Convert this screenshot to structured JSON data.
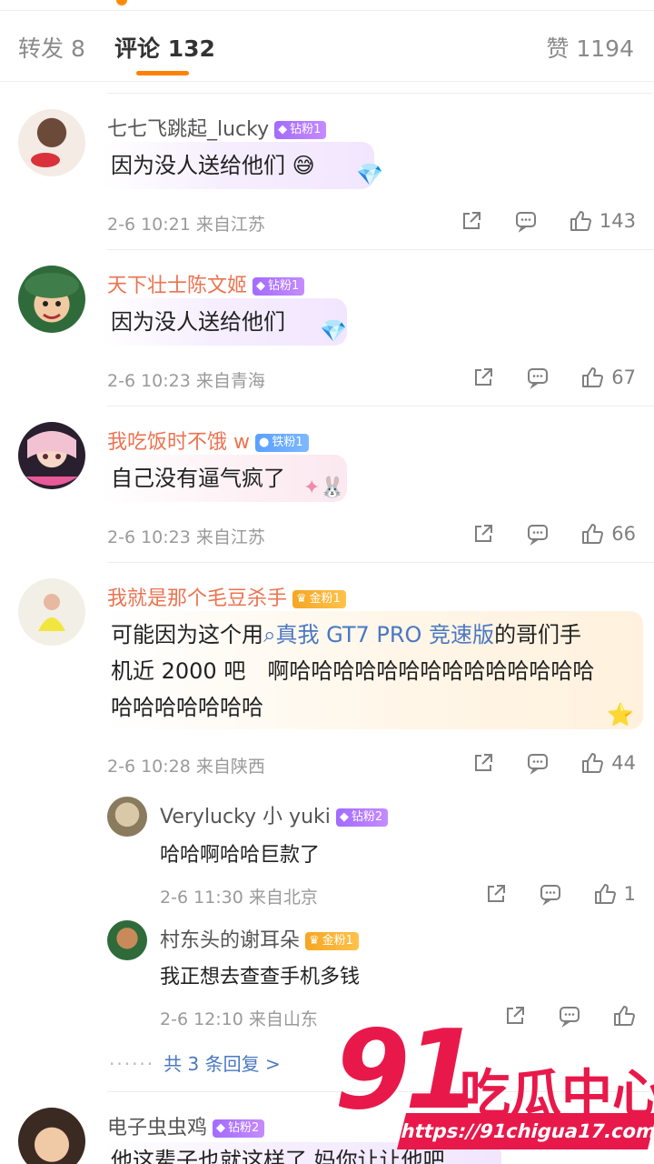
{
  "tabs": {
    "repost": "转发 8",
    "comment": "评论 132",
    "like": "赞 1194"
  },
  "comments": [
    {
      "user": "七七飞跳起_lucky",
      "badge": "钻粉1",
      "text": "因为没人送给他们",
      "time": "2-6 10:21 来自江苏",
      "likes": "143"
    },
    {
      "user": "天下壮士陈文姬",
      "badge": "钻粉1",
      "text": "因为没人送给他们",
      "time": "2-6 10:23 来自青海",
      "likes": "67"
    },
    {
      "user": "我吃饭时不饿 w",
      "badge": "铁粉1",
      "text": "自己没有逼气疯了",
      "time": "2-6 10:23 来自江苏",
      "likes": "66"
    },
    {
      "user": "我就是那个毛豆杀手",
      "badge": "金粉1",
      "text_pre": "可能因为这个用",
      "link": "真我 GT7 PRO 竞速版",
      "text_post": "的哥们手",
      "line2": "机近 2000 吧　啊哈哈哈哈哈哈哈哈哈哈哈哈哈哈",
      "line3": "哈哈哈哈哈哈哈",
      "time": "2-6 10:28 来自陕西",
      "likes": "44",
      "replies": [
        {
          "user": "Verylucky 小 yuki",
          "badge": "钻粉2",
          "text": "哈哈啊哈哈巨款了",
          "time": "2-6 11:30 来自北京",
          "likes": "1"
        },
        {
          "user": "村东头的谢耳朵",
          "badge": "金粉1",
          "text": "我正想去查查手机多钱",
          "time": "2-6 12:10 来自山东",
          "likes": ""
        }
      ],
      "more_replies": "共 3 条回复 >"
    },
    {
      "user": "电子虫虫鸡",
      "badge": "钻粉2",
      "text": "他这辈子也就这样了 妈你让让他吧"
    }
  ],
  "watermark": {
    "number": "91",
    "name": "吃瓜中心",
    "url": "https://91chigua17.com"
  },
  "colors": {
    "accent": "#ff8200",
    "link": "#4a78c2",
    "username_orange": "#eb7350",
    "watermark": "#e8194a"
  }
}
